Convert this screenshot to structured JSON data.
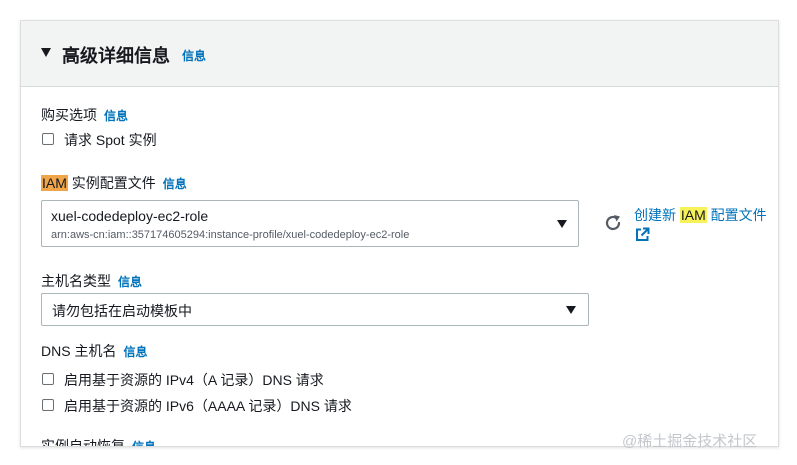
{
  "panel": {
    "title": "高级详细信息",
    "info": "信息"
  },
  "purchase": {
    "label": "购买选项",
    "info": "信息",
    "spot_label": "请求 Spot 实例"
  },
  "iam": {
    "label_highlight": "IAM",
    "label_rest": " 实例配置文件",
    "info": "信息",
    "selected_name": "xuel-codedeploy-ec2-role",
    "selected_arn": "arn:aws-cn:iam::357174605294:instance-profile/xuel-codedeploy-ec2-role",
    "create_link_prefix": "创建新 ",
    "create_link_highlight": "IAM",
    "create_link_suffix": " 配置文件"
  },
  "hostname_type": {
    "label": "主机名类型",
    "info": "信息",
    "selected": "请勿包括在启动模板中"
  },
  "dns_hostname": {
    "label": "DNS 主机名",
    "info": "信息",
    "ipv4_label": "启用基于资源的 IPv4（A 记录）DNS 请求",
    "ipv6_label": "启用基于资源的 IPv6（AAAA 记录）DNS 请求"
  },
  "recovery": {
    "label": "实例自动恢复",
    "info": "信息"
  },
  "watermark": "@稀土掘金技术社区",
  "colors": {
    "link": "#0073bb",
    "highlight_orange": "#f0a648",
    "highlight_yellow": "#f7f15a",
    "header_bg": "#f2f3f3"
  }
}
